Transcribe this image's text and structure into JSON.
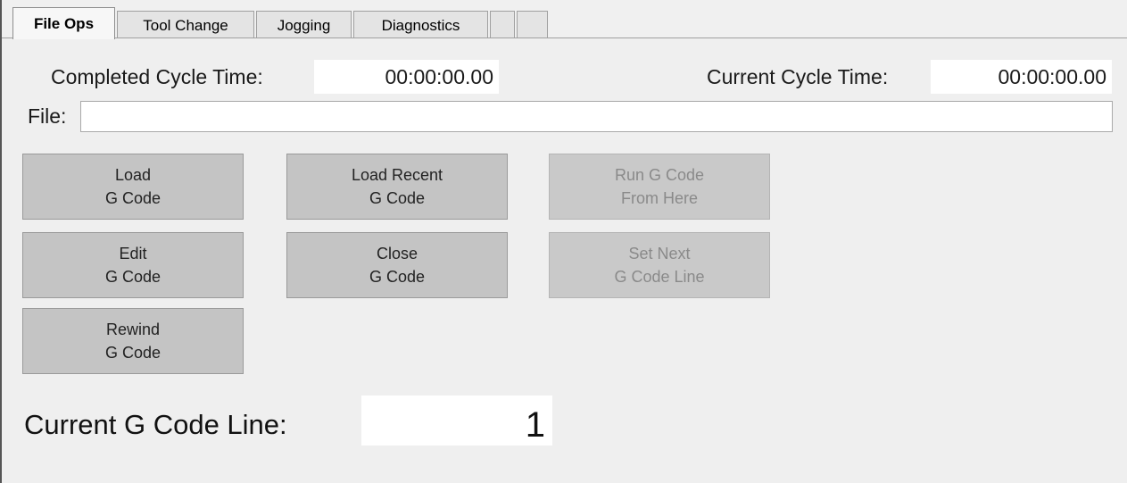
{
  "tabs": [
    {
      "label": "File Ops",
      "active": true
    },
    {
      "label": "Tool Change",
      "active": false
    },
    {
      "label": "Jogging",
      "active": false
    },
    {
      "label": "Diagnostics",
      "active": false
    },
    {
      "label": "",
      "active": false
    },
    {
      "label": "",
      "active": false
    }
  ],
  "cycle": {
    "completed_label": "Completed Cycle Time:",
    "completed_value": "00:00:00.00",
    "current_label": "Current Cycle Time:",
    "current_value": "00:00:00.00"
  },
  "file": {
    "label": "File:",
    "value": ""
  },
  "buttons": {
    "load": {
      "line1": "Load",
      "line2": "G Code",
      "enabled": true
    },
    "load_recent": {
      "line1": "Load Recent",
      "line2": "G Code",
      "enabled": true
    },
    "run_from_here": {
      "line1": "Run G Code",
      "line2": "From Here",
      "enabled": false
    },
    "edit": {
      "line1": "Edit",
      "line2": "G Code",
      "enabled": true
    },
    "close": {
      "line1": "Close",
      "line2": "G Code",
      "enabled": true
    },
    "set_next": {
      "line1": "Set Next",
      "line2": "G Code Line",
      "enabled": false
    },
    "rewind": {
      "line1": "Rewind",
      "line2": "G Code",
      "enabled": true
    }
  },
  "current_line": {
    "label": "Current G Code Line:",
    "value": "1"
  }
}
